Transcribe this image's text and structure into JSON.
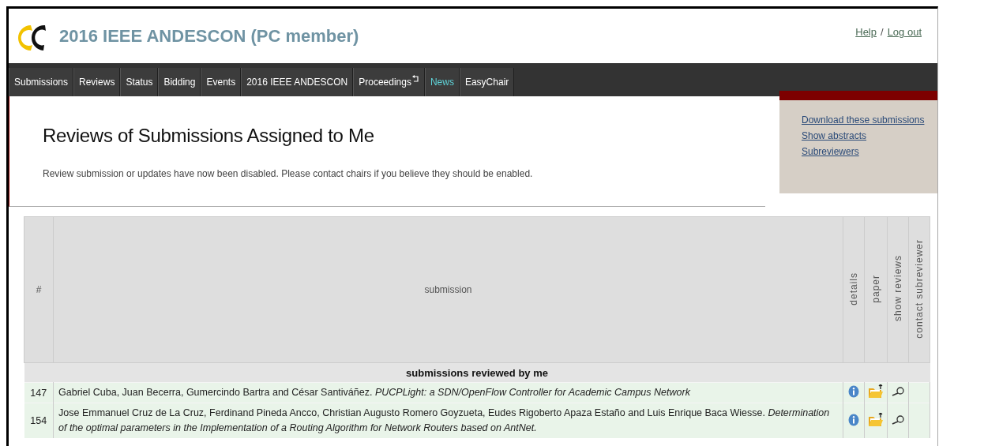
{
  "header": {
    "title": "2016 IEEE ANDESCON (PC member)",
    "links": [
      "Help",
      "Log out"
    ],
    "separator": "/"
  },
  "nav": [
    {
      "label": "Submissions",
      "selected": false,
      "kind": "plain"
    },
    {
      "label": "Reviews",
      "selected": false,
      "kind": "plain"
    },
    {
      "label": "Status",
      "selected": false,
      "kind": "plain"
    },
    {
      "label": "Bidding",
      "selected": false,
      "kind": "plain"
    },
    {
      "label": "Events",
      "selected": false,
      "kind": "plain"
    },
    {
      "label": "2016 IEEE ANDESCON",
      "selected": false,
      "kind": "plain"
    },
    {
      "label": "Proceedings",
      "selected": false,
      "kind": "arrow"
    },
    {
      "label": "News",
      "selected": true,
      "kind": "plain"
    },
    {
      "label": "EasyChair",
      "selected": false,
      "kind": "plain"
    }
  ],
  "page": {
    "heading": "Reviews of Submissions Assigned to Me",
    "notice": "Review submission or updates have now been disabled. Please contact chairs if you believe they should be enabled."
  },
  "sidebar_links": [
    "Download these submissions",
    "Show abstracts",
    "Subreviewers"
  ],
  "table": {
    "columns": [
      "#",
      "submission",
      "details",
      "paper",
      "show reviews",
      "contact subreviewer"
    ],
    "groups": [
      {
        "title": "submissions reviewed by me",
        "rows": [
          {
            "number": "147",
            "submission": "Gabriel Cuba, Juan Becerra, Gumercindo Bartra and César Santiváñez. *PUCPLight: a SDN/OpenFlow Controller for Academic Campus Network*"
          },
          {
            "number": "154",
            "submission": "Jose Emmanuel Cruz de La Cruz, Ferdinand Pineda Ancco, Christian Augusto Romero Goyzueta, Eudes Rigoberto Apaza Estaño and Luis Enrique Baca Wiesse. *Determination of the optimal parameters in the Implementation of a Routing Algorithm for Network Routers based on AntNet.*"
          }
        ]
      }
    ]
  }
}
